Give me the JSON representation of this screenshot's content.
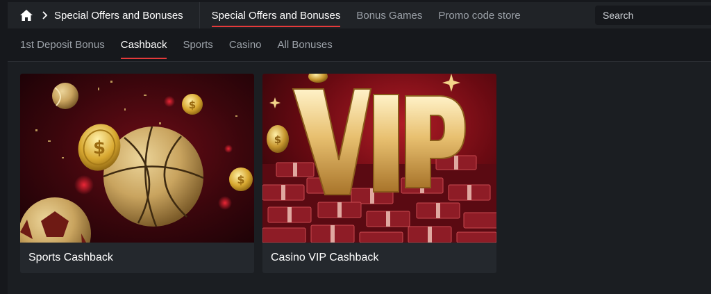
{
  "breadcrumb": {
    "home_icon": "home-icon",
    "separator_icon": "chevron-right-icon",
    "label": "Special Offers and Bonuses"
  },
  "topnav": {
    "items": [
      {
        "label": "Special Offers and Bonuses",
        "active": true
      },
      {
        "label": "Bonus Games",
        "active": false
      },
      {
        "label": "Promo code store",
        "active": false
      }
    ]
  },
  "search": {
    "placeholder": "Search",
    "value": ""
  },
  "subnav": {
    "tabs": [
      {
        "label": "1st Deposit Bonus",
        "active": false
      },
      {
        "label": "Cashback",
        "active": true
      },
      {
        "label": "Sports",
        "active": false
      },
      {
        "label": "Casino",
        "active": false
      },
      {
        "label": "All Bonuses",
        "active": false
      }
    ]
  },
  "cards": [
    {
      "title": "Sports Cashback",
      "image": "sports-balls-coins-illustration"
    },
    {
      "title": "Casino VIP Cashback",
      "image": "vip-letters-money-stacks-illustration",
      "image_text": "VIP"
    }
  ],
  "colors": {
    "accent": "#e53a3a",
    "page_bg": "#16181c",
    "bar_bg": "#202327",
    "card_bg": "#24282d"
  }
}
